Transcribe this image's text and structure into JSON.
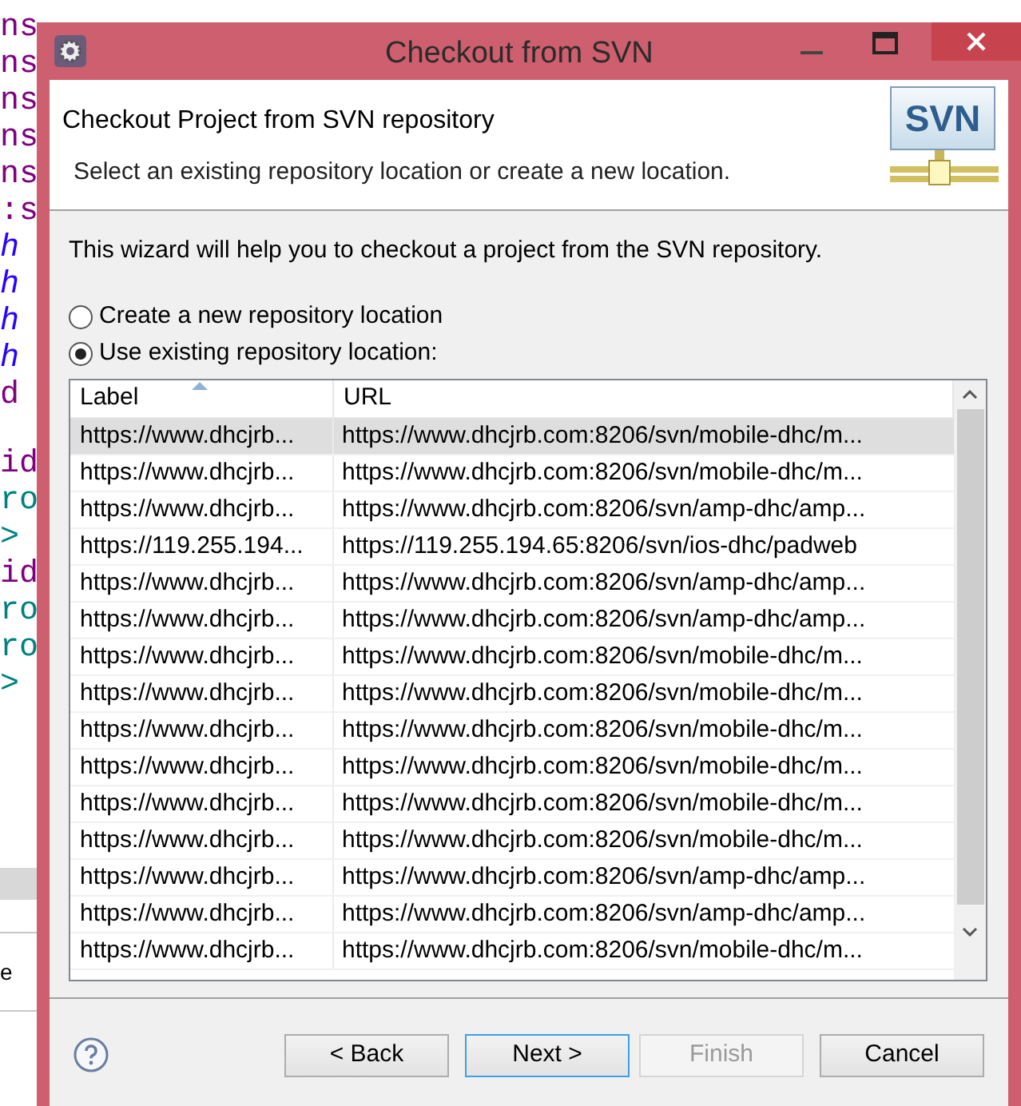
{
  "editor": {
    "gutter": [
      {
        "text": "ns",
        "kind": "attr"
      },
      {
        "text": "ns",
        "kind": "attr"
      },
      {
        "text": "ns",
        "kind": "attr"
      },
      {
        "text": "ns",
        "kind": "attr"
      },
      {
        "text": "ns",
        "kind": "attr"
      },
      {
        "text": ":s",
        "kind": "attr"
      },
      {
        "text": "h",
        "kind": "string"
      },
      {
        "text": "h",
        "kind": "string"
      },
      {
        "text": "h",
        "kind": "string"
      },
      {
        "text": "h",
        "kind": "string"
      },
      {
        "text": "d",
        "kind": "attr"
      }
    ],
    "gutter_lower": [
      {
        "text": "id",
        "kind": "attr"
      },
      {
        "text": "ro",
        "kind": "tag"
      },
      {
        "text": ">",
        "kind": "tag"
      },
      {
        "text": "id",
        "kind": "attr"
      },
      {
        "text": "ro",
        "kind": "tag"
      },
      {
        "text": "ro",
        "kind": "tag"
      },
      {
        "text": ">",
        "kind": "tag"
      }
    ],
    "tab": "e"
  },
  "window": {
    "title": "Checkout from SVN"
  },
  "header": {
    "title": "Checkout Project from SVN repository",
    "subtitle": "Select an existing repository location or create a new location.",
    "logo": "SVN"
  },
  "intro": "This wizard will help you to checkout a project from the SVN repository.",
  "options": [
    {
      "label": "Create a new repository location",
      "selected": false
    },
    {
      "label": "Use existing repository location:",
      "selected": true
    }
  ],
  "table": {
    "columns": [
      "Label",
      "URL"
    ],
    "rows": [
      {
        "label": "https://www.dhcjrb...",
        "url": "https://www.dhcjrb.com:8206/svn/mobile-dhc/m...",
        "selected": true
      },
      {
        "label": "https://www.dhcjrb...",
        "url": "https://www.dhcjrb.com:8206/svn/mobile-dhc/m...",
        "selected": false
      },
      {
        "label": "https://www.dhcjrb...",
        "url": "https://www.dhcjrb.com:8206/svn/amp-dhc/amp...",
        "selected": false
      },
      {
        "label": "https://119.255.194...",
        "url": "https://119.255.194.65:8206/svn/ios-dhc/padweb",
        "selected": false
      },
      {
        "label": "https://www.dhcjrb...",
        "url": "https://www.dhcjrb.com:8206/svn/amp-dhc/amp...",
        "selected": false
      },
      {
        "label": "https://www.dhcjrb...",
        "url": "https://www.dhcjrb.com:8206/svn/amp-dhc/amp...",
        "selected": false
      },
      {
        "label": "https://www.dhcjrb...",
        "url": "https://www.dhcjrb.com:8206/svn/mobile-dhc/m...",
        "selected": false
      },
      {
        "label": "https://www.dhcjrb...",
        "url": "https://www.dhcjrb.com:8206/svn/mobile-dhc/m...",
        "selected": false
      },
      {
        "label": "https://www.dhcjrb...",
        "url": "https://www.dhcjrb.com:8206/svn/mobile-dhc/m...",
        "selected": false
      },
      {
        "label": "https://www.dhcjrb...",
        "url": "https://www.dhcjrb.com:8206/svn/mobile-dhc/m...",
        "selected": false
      },
      {
        "label": "https://www.dhcjrb...",
        "url": "https://www.dhcjrb.com:8206/svn/mobile-dhc/m...",
        "selected": false
      },
      {
        "label": "https://www.dhcjrb...",
        "url": "https://www.dhcjrb.com:8206/svn/mobile-dhc/m...",
        "selected": false
      },
      {
        "label": "https://www.dhcjrb...",
        "url": "https://www.dhcjrb.com:8206/svn/amp-dhc/amp...",
        "selected": false
      },
      {
        "label": "https://www.dhcjrb...",
        "url": "https://www.dhcjrb.com:8206/svn/amp-dhc/amp...",
        "selected": false
      },
      {
        "label": "https://www.dhcjrb...",
        "url": "https://www.dhcjrb.com:8206/svn/mobile-dhc/m...",
        "selected": false
      }
    ]
  },
  "buttons": [
    {
      "label": "< Back",
      "disabled": false,
      "default": false
    },
    {
      "label": "Next >",
      "disabled": false,
      "default": true
    },
    {
      "label": "Finish",
      "disabled": true,
      "default": false
    },
    {
      "label": "Cancel",
      "disabled": false,
      "default": false
    }
  ]
}
